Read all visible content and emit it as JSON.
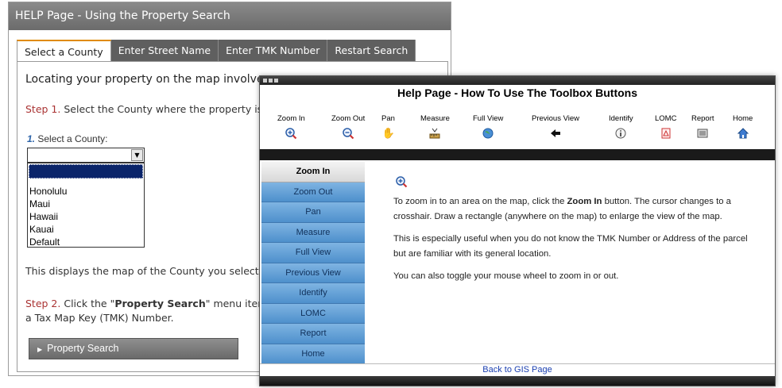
{
  "back_window": {
    "title": "HELP Page - Using the Property Search",
    "tabs": [
      {
        "label": "Select a County",
        "active": true
      },
      {
        "label": "Enter Street Name",
        "active": false
      },
      {
        "label": "Enter TMK Number",
        "active": false
      },
      {
        "label": "Restart Search",
        "active": false
      }
    ],
    "intro": "Locating your property on the map involves a",
    "step1": {
      "prefix": "Step 1.",
      "text": " Select the County where the property is"
    },
    "county_label": {
      "num": "1.",
      "text": " Select a County:"
    },
    "county_select_value": "",
    "county_options": [
      "Honolulu",
      "Maui",
      "Hawaii",
      "Kauai",
      "Default"
    ],
    "displays_text": "This displays the map of the County you selected.",
    "step2": {
      "prefix": "Step 2.",
      "text_a": " Click the \"",
      "bold": "Property Search",
      "text_b": "\" menu item ar",
      "line2": "a Tax Map Key (TMK) Number."
    },
    "property_search_button": "Property Search"
  },
  "front_window": {
    "title": "Help Page - How To Use The Toolbox Buttons",
    "tools": [
      {
        "label": "Zoom In",
        "icon": "zoom-in-icon"
      },
      {
        "label": "Zoom Out",
        "icon": "zoom-out-icon"
      },
      {
        "label": "Pan",
        "icon": "hand-icon"
      },
      {
        "label": "Measure",
        "icon": "measure-icon"
      },
      {
        "label": "Full View",
        "icon": "globe-icon"
      },
      {
        "label": "Previous View",
        "icon": "back-arrow-icon"
      },
      {
        "label": "Identify",
        "icon": "info-icon"
      },
      {
        "label": "LOMC",
        "icon": "lomc-icon"
      },
      {
        "label": "Report",
        "icon": "report-icon"
      },
      {
        "label": "Home",
        "icon": "home-icon"
      }
    ],
    "nav": [
      {
        "label": "Zoom In",
        "active": true
      },
      {
        "label": "Zoom Out",
        "active": false
      },
      {
        "label": "Pan",
        "active": false
      },
      {
        "label": "Measure",
        "active": false
      },
      {
        "label": "Full View",
        "active": false
      },
      {
        "label": "Previous View",
        "active": false
      },
      {
        "label": "Identify",
        "active": false
      },
      {
        "label": "LOMC",
        "active": false
      },
      {
        "label": "Report",
        "active": false
      },
      {
        "label": "Home",
        "active": false
      }
    ],
    "content": {
      "p1_a": "To zoom in to an area on the map, click the ",
      "p1_bold": "Zoom In",
      "p1_b": " button. The cursor changes to a crosshair. Draw a rectangle (anywhere on the map) to enlarge the view of the map.",
      "p2": "This is especially useful when you do not know the TMK Number or Address of the parcel but are familiar with its general location.",
      "p3": "You can also toggle your mouse wheel to zoom in or out."
    },
    "footer_link": "Back to GIS Page"
  }
}
